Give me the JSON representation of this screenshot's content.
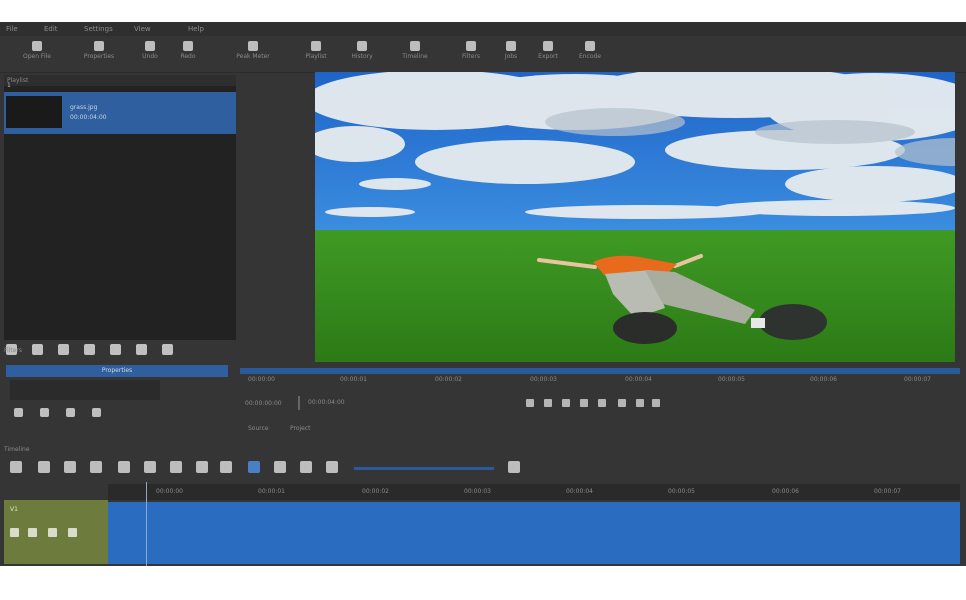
{
  "menubar": {
    "items": [
      "File",
      "Edit",
      "Settings",
      "View",
      "Help"
    ]
  },
  "toolbar": {
    "buttons": [
      {
        "label": "Open File"
      },
      {
        "label": "Properties"
      },
      {
        "label": "Undo"
      },
      {
        "label": "Redo"
      },
      {
        "label": "Peak Meter"
      },
      {
        "label": "Playlist"
      },
      {
        "label": "History"
      },
      {
        "label": "Timeline"
      },
      {
        "label": "Filters"
      },
      {
        "label": "Jobs"
      },
      {
        "label": "Export"
      },
      {
        "label": "Encode"
      }
    ]
  },
  "playlist": {
    "header": "Playlist",
    "clip_number": "1",
    "clip_name": "grass.jpg",
    "clip_detail": "00:00:04:00",
    "controls": [
      "add",
      "remove",
      "up",
      "down",
      "menu",
      "grid",
      "list"
    ]
  },
  "properties": {
    "header": "Filters",
    "tab": "Properties"
  },
  "ruler": {
    "ticks": [
      "00:00:00",
      "00:00:01",
      "00:00:02",
      "00:00:03",
      "00:00:04",
      "00:00:05",
      "00:00:06",
      "00:00:07"
    ]
  },
  "transport": {
    "timecode_label": "00:00:00:00",
    "timecode_value": "00:00:04:00",
    "tabs": {
      "source": "Source",
      "project": "Project"
    }
  },
  "timeline": {
    "header": "Timeline",
    "ruler_ticks": [
      "00:00:00",
      "00:00:01",
      "00:00:02",
      "00:00:03",
      "00:00:04",
      "00:00:05",
      "00:00:06",
      "00:00:07"
    ],
    "track_label": "V1",
    "track_color": "#6d7c3c",
    "clip_color": "#2a6cc0"
  },
  "colors": {
    "accent": "#2f5f9e",
    "background": "#353535"
  }
}
